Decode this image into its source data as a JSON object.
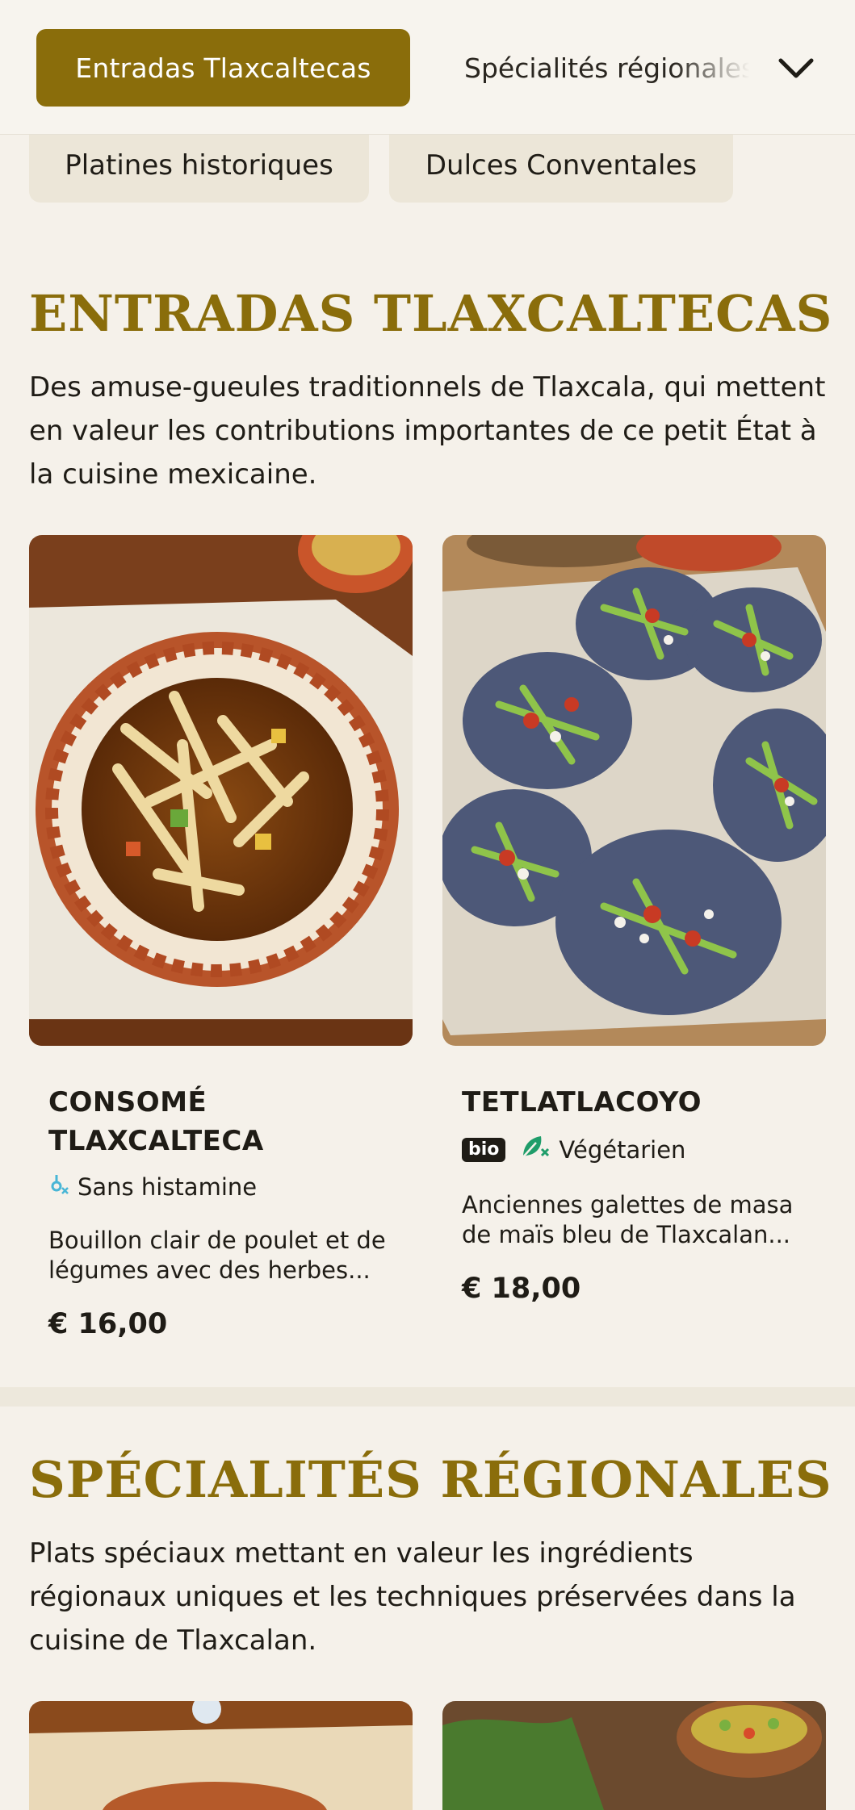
{
  "category_nav": {
    "active": "Entradas Tlaxcaltecas",
    "next": "Spécialités régionales",
    "chevron_icon": "chevron-down-icon",
    "more": [
      "Platines historiques",
      "Dulces Conventales"
    ]
  },
  "sections": [
    {
      "title": "ENTRADAS TLAXCALTECAS",
      "description": "Des amuse-gueules traditionnels de Tlaxcala, qui mettent en valeur les contributions importantes de ce petit État à la cuisine mexicaine.",
      "items": [
        {
          "name": "CONSOMÉ TLAXCALTECA",
          "tag_icon": "histamine-free-icon",
          "tag": "Sans histamine",
          "description": "Bouillon clair de poulet et de légumes avec des herbes...",
          "price": "€ 16,00"
        },
        {
          "name": "TETLATLACOYO",
          "badge": "bio",
          "tag_icon": "vegetarian-icon",
          "tag": "Végétarien",
          "description": "Anciennes galettes de masa de maïs bleu de Tlaxcalan...",
          "price": "€ 18,00"
        }
      ]
    },
    {
      "title": "SPÉCIALITÉS RÉGIONALES",
      "description": "Plats spéciaux mettant en valeur les ingrédients régionaux uniques et les techniques préservées dans la cuisine de Tlaxcalan."
    }
  ],
  "colors": {
    "accent": "#8a6d0b",
    "background": "#f5f1ea",
    "pill_secondary": "#ece6d8",
    "vegetarian_green": "#1f9d6a",
    "histamine_blue": "#49b6d6"
  }
}
